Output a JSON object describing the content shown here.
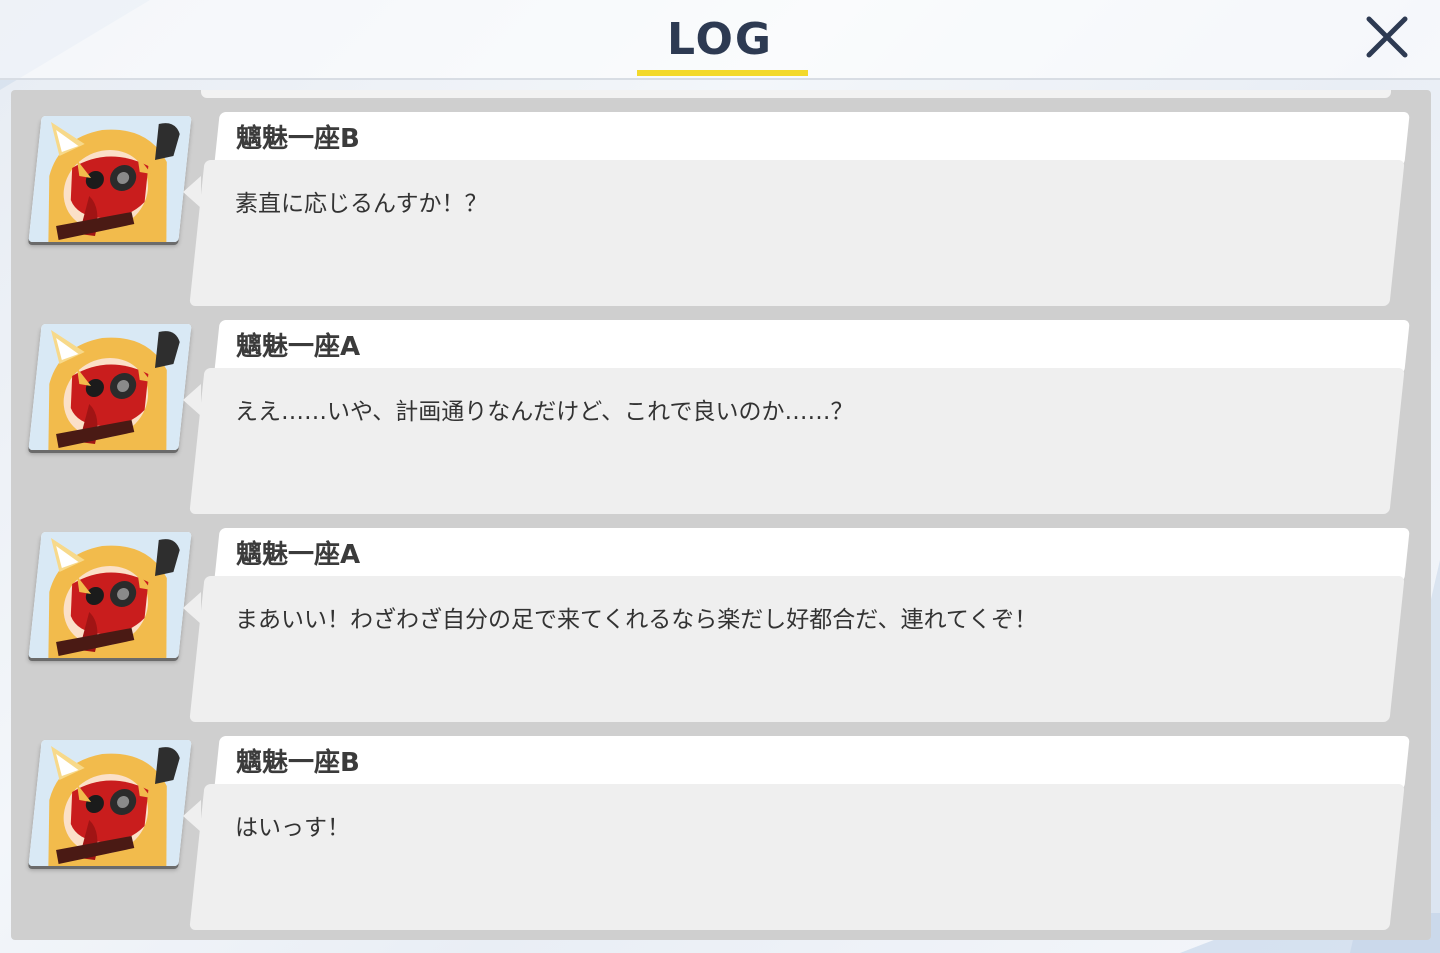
{
  "header": {
    "title": "LOG",
    "close_icon": "close-icon"
  },
  "colors": {
    "accent_underline": "#f3d92b",
    "title_text": "#2d3a52",
    "panel_bg": "#cfcfcf",
    "bubble_bg": "#efefef"
  },
  "log": {
    "entries": [
      {
        "speaker": "魑魅一座B",
        "text": "素直に応じるんすか！？",
        "avatar": "masked-fox-girl-avatar"
      },
      {
        "speaker": "魑魅一座A",
        "text": "ええ……いや、計画通りなんだけど、これで良いのか……？",
        "avatar": "masked-fox-girl-avatar"
      },
      {
        "speaker": "魑魅一座A",
        "text": "まあいい！わざわざ自分の足で来てくれるなら楽だし好都合だ、連れてくぞ！",
        "avatar": "masked-fox-girl-avatar"
      },
      {
        "speaker": "魑魅一座B",
        "text": "はいっす！",
        "avatar": "masked-fox-girl-avatar"
      }
    ]
  }
}
